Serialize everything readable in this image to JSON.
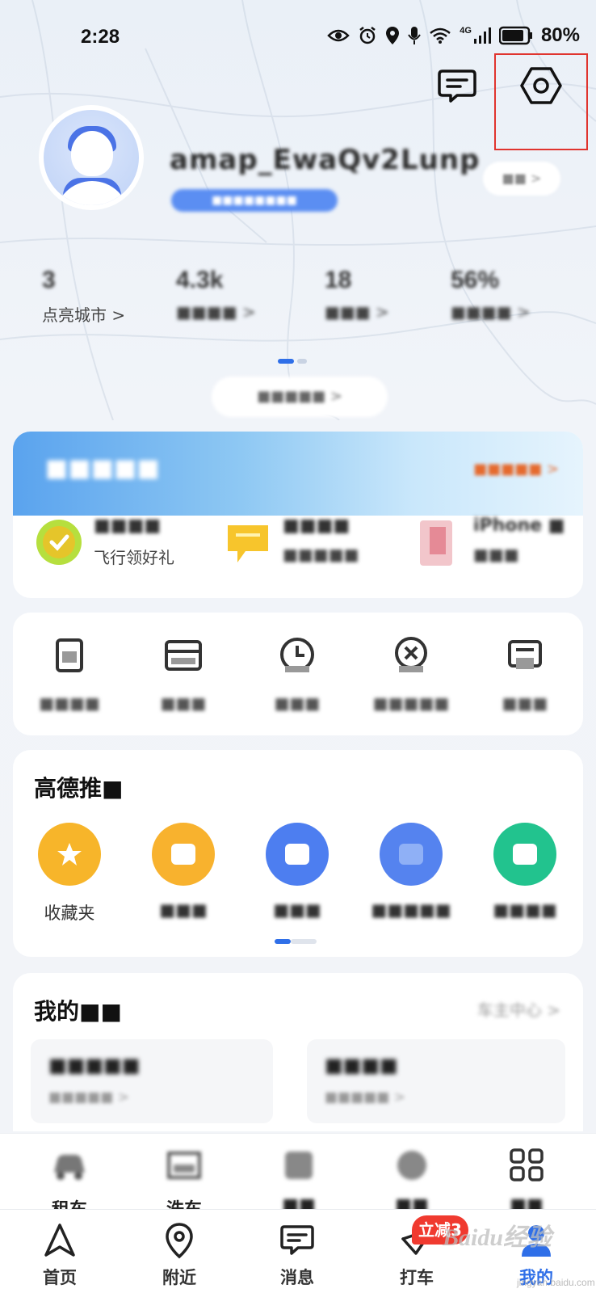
{
  "status_bar": {
    "time": "2:28",
    "network": "4G",
    "battery": "80%"
  },
  "header": {
    "message_icon": "message-icon",
    "settings_icon": "settings-hex-icon"
  },
  "profile": {
    "username": "amap_EwaQv2Lunp",
    "badge_text": "■■■■■■■■",
    "link_text": "■■ >"
  },
  "stats": [
    {
      "value": "3",
      "label": "点亮城市 >"
    },
    {
      "value": "4.3k",
      "label": "■■■■ >"
    },
    {
      "value": "18",
      "label": "■■■ >"
    },
    {
      "value": "56%",
      "label": "■■■■ >"
    }
  ],
  "review_pill": "■■■■■ >",
  "promo": {
    "title": "■■■■■",
    "more": "■■■■■ >",
    "items": [
      {
        "title": "■■■■",
        "subtitle": "飞行领好礼",
        "icon": "coin-icon"
      },
      {
        "title": "■■■■",
        "subtitle": "■■■■■",
        "icon": "flag-icon"
      },
      {
        "title": "iPhone ■",
        "subtitle": "■■■",
        "icon": "phone-icon"
      }
    ]
  },
  "tools": [
    {
      "label": "■■■■",
      "icon": "order-icon"
    },
    {
      "label": "■■■",
      "icon": "wallet-icon"
    },
    {
      "label": "■■■",
      "icon": "clock-icon"
    },
    {
      "label": "■■■■■",
      "icon": "location-cancel-icon"
    },
    {
      "label": "■■■",
      "icon": "document-icon"
    }
  ],
  "recommend": {
    "title": "高德推■",
    "items": [
      {
        "label": "收藏夹",
        "color": "#f7b52a",
        "icon": "star-folder-icon"
      },
      {
        "label": "■■■",
        "color": "#f8b22e",
        "icon": "card-icon"
      },
      {
        "label": "■■■",
        "color": "#4d7ef0",
        "icon": "calendar-icon"
      },
      {
        "label": "■■■■■",
        "color": "#5583ef",
        "icon": "grid-icon"
      },
      {
        "label": "■■■■",
        "color": "#22c38e",
        "icon": "box-icon"
      }
    ]
  },
  "car": {
    "title": "我的■■",
    "more": "车主中心 >",
    "boxes": [
      {
        "title": "■■■■■",
        "subtitle": "■■■■■ >"
      },
      {
        "title": "■■■■",
        "subtitle": "■■■■■ >"
      }
    ]
  },
  "services": [
    {
      "label": "租车",
      "icon": "rent-car-icon"
    },
    {
      "label": "洗车",
      "icon": "car-wash-icon"
    },
    {
      "label": "■■",
      "icon": "service-icon"
    },
    {
      "label": "■■",
      "icon": "service-icon"
    },
    {
      "label": "■■",
      "icon": "apps-icon"
    }
  ],
  "tabbar": {
    "items": [
      {
        "label": "首页",
        "icon": "navigate-arrow-icon"
      },
      {
        "label": "附近",
        "icon": "location-pin-icon"
      },
      {
        "label": "消息",
        "icon": "message-icon"
      },
      {
        "label": "打车",
        "icon": "taxi-icon"
      },
      {
        "label": "我的",
        "icon": "profile-icon"
      }
    ],
    "badge": "立减3",
    "active_index": 4,
    "active_color": "#2f6fe8"
  },
  "watermark": {
    "logo": "Baidu经验",
    "sub": "jingyan.baidu.com"
  }
}
